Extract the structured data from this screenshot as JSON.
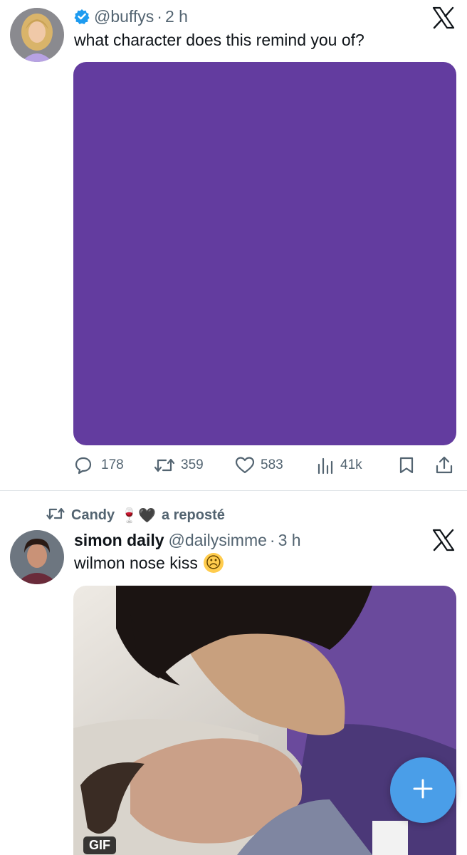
{
  "post1": {
    "handle": "@buffys",
    "dot": "·",
    "time": "2 h",
    "text": "what character does this remind you of?",
    "media_color": "#633c9f",
    "actions": {
      "replies": "178",
      "reposts": "359",
      "likes": "583",
      "views": "41k"
    }
  },
  "repost_banner": {
    "user": "Candy",
    "emoji": "🍷🖤",
    "suffix": "a reposté"
  },
  "post2": {
    "name": "simon daily",
    "handle": "@dailysimme",
    "dot": "·",
    "time": "3 h",
    "text": "wilmon nose kiss",
    "emoji": "☹",
    "media_badge": "GIF"
  },
  "icons": {
    "verified": "verified-badge-icon",
    "x_logo": "x-logo-icon",
    "reply": "reply-icon",
    "repost": "repost-icon",
    "like": "heart-icon",
    "views": "views-icon",
    "bookmark": "bookmark-icon",
    "share": "share-icon",
    "compose": "plus-icon"
  },
  "colors": {
    "accent": "#1d9bf0",
    "fab": "#4a9ee8",
    "muted": "#536471"
  }
}
